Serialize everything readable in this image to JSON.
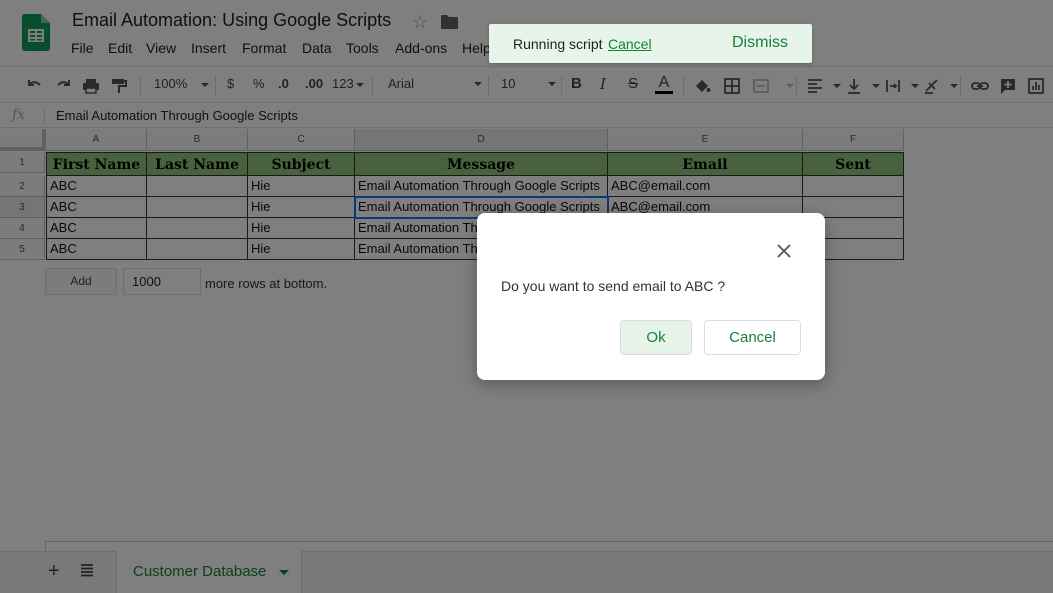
{
  "header": {
    "title": "Email Automation: Using Google Scripts",
    "menu": [
      "File",
      "Edit",
      "View",
      "Insert",
      "Format",
      "Data",
      "Tools",
      "Add-ons",
      "Help"
    ]
  },
  "toolbar": {
    "zoom": "100%",
    "currency": "$",
    "percent": "%",
    "decrease_decimals": ".0",
    "increase_decimals": ".00",
    "more_formats": "123",
    "font": "Arial",
    "font_size": "10",
    "bold": "B",
    "italic": "I",
    "strike": "S",
    "text_color_label": "A",
    "text_color": "#000000"
  },
  "formula_bar": {
    "fx_label": "fx",
    "value": "Email Automation Through Google Scripts"
  },
  "sheet": {
    "columns": [
      "A",
      "B",
      "C",
      "D",
      "E",
      "F"
    ],
    "row_numbers": [
      "1",
      "2",
      "3",
      "4",
      "5"
    ],
    "header_row": [
      "First Name",
      "Last Name",
      "Subject",
      "Message",
      "Email",
      "Sent"
    ],
    "rows": [
      [
        "ABC",
        "",
        "Hie",
        "Email Automation Through Google Scripts",
        "ABC@email.com",
        ""
      ],
      [
        "ABC",
        "",
        "Hie",
        "Email Automation Through Google Scripts",
        "ABC@email.com",
        ""
      ],
      [
        "ABC",
        "",
        "Hie",
        "Email Automation Through Google Scripts",
        "",
        ""
      ],
      [
        "ABC",
        "",
        "Hie",
        "Email Automation Through Google Scripts",
        "",
        ""
      ]
    ],
    "header_fill": "#93c47d",
    "add_button": "Add",
    "add_rows_value": "1000",
    "add_rows_suffix": "more rows at bottom."
  },
  "bottom": {
    "sheet_tab": "Customer Database",
    "add_sheet": "+"
  },
  "toast": {
    "text": "Running script",
    "cancel": "Cancel",
    "dismiss": "Dismiss"
  },
  "dialog": {
    "message": "Do you want to send email to ABC ?",
    "ok": "Ok",
    "cancel": "Cancel"
  },
  "colors": {
    "accent": "#188038",
    "selection": "#1a73e8"
  }
}
